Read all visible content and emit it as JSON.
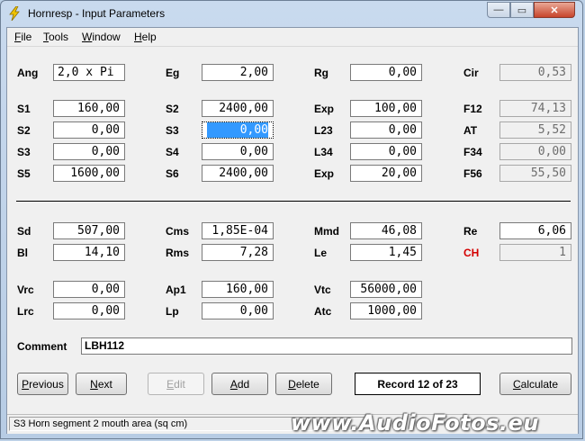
{
  "window": {
    "title": "Hornresp - Input Parameters",
    "icon": "lightning-bolt-icon",
    "min_glyph": "—",
    "max_glyph": "▭",
    "close_glyph": "✕"
  },
  "menu": {
    "file": {
      "mnemonic": "F",
      "rest": "ile"
    },
    "tools": {
      "mnemonic": "T",
      "rest": "ools"
    },
    "window": {
      "mnemonic": "W",
      "rest": "indow"
    },
    "help": {
      "mnemonic": "H",
      "rest": "elp"
    }
  },
  "params": {
    "ang": {
      "label": "Ang",
      "value": "2,0 x Pi"
    },
    "eg": {
      "label": "Eg",
      "value": "2,00"
    },
    "rg": {
      "label": "Rg",
      "value": "0,00"
    },
    "cir": {
      "label": "Cir",
      "value": "0,53"
    },
    "s1": {
      "label": "S1",
      "value": "160,00"
    },
    "s2a": {
      "label": "S2",
      "value": "2400,00"
    },
    "exp1": {
      "label": "Exp",
      "value": "100,00"
    },
    "f12": {
      "label": "F12",
      "value": "74,13"
    },
    "s2b": {
      "label": "S2",
      "value": "0,00"
    },
    "s3a": {
      "label": "S3",
      "value": "0,00"
    },
    "l23": {
      "label": "L23",
      "value": "0,00"
    },
    "at": {
      "label": "AT",
      "value": "5,52"
    },
    "s3b": {
      "label": "S3",
      "value": "0,00"
    },
    "s4": {
      "label": "S4",
      "value": "0,00"
    },
    "l34": {
      "label": "L34",
      "value": "0,00"
    },
    "f34": {
      "label": "F34",
      "value": "0,00"
    },
    "s5": {
      "label": "S5",
      "value": "1600,00"
    },
    "s6": {
      "label": "S6",
      "value": "2400,00"
    },
    "exp2": {
      "label": "Exp",
      "value": "20,00"
    },
    "f56": {
      "label": "F56",
      "value": "55,50"
    },
    "sd": {
      "label": "Sd",
      "value": "507,00"
    },
    "cms": {
      "label": "Cms",
      "value": "1,85E-04"
    },
    "mmd": {
      "label": "Mmd",
      "value": "46,08"
    },
    "re": {
      "label": "Re",
      "value": "6,06"
    },
    "bl": {
      "label": "Bl",
      "value": "14,10"
    },
    "rms": {
      "label": "Rms",
      "value": "7,28"
    },
    "le": {
      "label": "Le",
      "value": "1,45"
    },
    "ch": {
      "label": "CH",
      "value": "1"
    },
    "vrc": {
      "label": "Vrc",
      "value": "0,00"
    },
    "ap1": {
      "label": "Ap1",
      "value": "160,00"
    },
    "vtc": {
      "label": "Vtc",
      "value": "56000,00"
    },
    "lrc": {
      "label": "Lrc",
      "value": "0,00"
    },
    "lp": {
      "label": "Lp",
      "value": "0,00"
    },
    "atc": {
      "label": "Atc",
      "value": "1000,00"
    }
  },
  "comment": {
    "label": "Comment",
    "value": "LBH112"
  },
  "buttons": {
    "previous": {
      "mnemonic": "P",
      "rest": "revious"
    },
    "next": {
      "mnemonic": "N",
      "rest": "ext"
    },
    "edit": {
      "mnemonic": "E",
      "rest": "dit"
    },
    "add": {
      "mnemonic": "A",
      "rest": "dd"
    },
    "delete": {
      "mnemonic": "D",
      "rest": "elete"
    },
    "calculate": {
      "mnemonic": "C",
      "rest": "alculate"
    }
  },
  "record": "Record 12 of 23",
  "status": "S3   Horn segment 2 mouth area  (sq cm)",
  "watermark": "www.AudioFotos.eu",
  "colors": {
    "highlight": "#3399ff",
    "ch_label": "#d40000",
    "close_button": "#c7442b"
  }
}
